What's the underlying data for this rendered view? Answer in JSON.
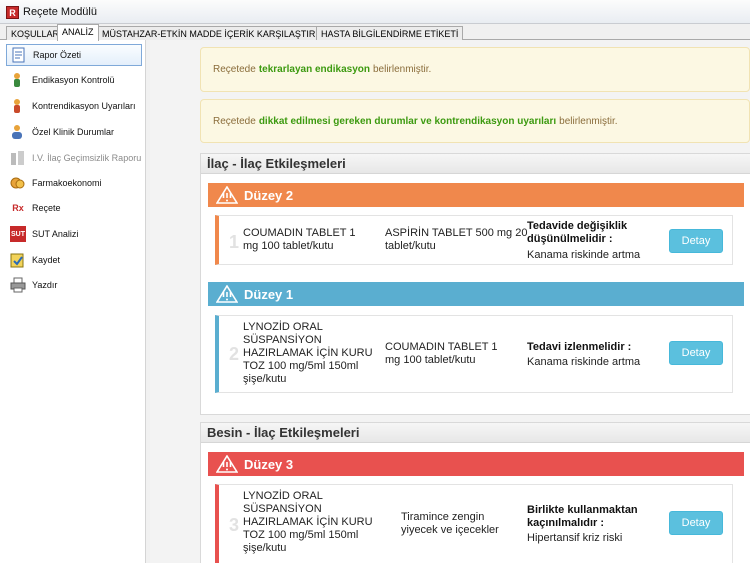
{
  "window": {
    "title": "Reçete Modülü",
    "icon": "app-logo-icon"
  },
  "tabs": [
    {
      "label": "KOŞULLAR",
      "active": false
    },
    {
      "label": "ANALİZ",
      "active": true
    },
    {
      "label": "MÜSTAHZAR-ETKİN MADDE İÇERİK KARŞILAŞTIRMA",
      "active": false
    },
    {
      "label": "HASTA BİLGİLENDİRME ETİKETİ",
      "active": false
    }
  ],
  "sidebar": {
    "items": [
      {
        "label": "Rapor Özeti",
        "icon": "report-icon",
        "active": true
      },
      {
        "label": "Endikasyon Kontrolü",
        "icon": "indication-icon"
      },
      {
        "label": "Kontrendikasyon Uyarıları",
        "icon": "contraindication-icon"
      },
      {
        "label": "Özel Klinik Durumlar",
        "icon": "patient-icon"
      },
      {
        "label": "I.V. İlaç Geçimsizlik Raporu",
        "icon": "iv-icon",
        "disabled": true
      },
      {
        "label": "Farmakoekonomi",
        "icon": "coins-icon"
      },
      {
        "label": "Reçete",
        "icon": "rx-icon"
      },
      {
        "label": "SUT Analizi",
        "icon": "sut-icon"
      },
      {
        "label": "Kaydet",
        "icon": "save-icon"
      },
      {
        "label": "Yazdır",
        "icon": "printer-icon"
      }
    ]
  },
  "alerts": [
    {
      "prefix": "Reçetede",
      "highlight": "tekrarlayan endikasyon",
      "suffix": "belirlenmiştir."
    },
    {
      "prefix": "Reçetede",
      "highlight": "dikkat edilmesi gereken durumlar ve kontrendikasyon uyarıları",
      "suffix": "belirlenmiştir."
    }
  ],
  "drug_interactions": {
    "title": "İlaç - İlaç Etkileşmeleri",
    "levels": [
      {
        "label": "Düzey 2",
        "color": "#f0884c",
        "card": {
          "number": "1",
          "drug1": "COUMADIN TABLET 1 mg 100 tablet/kutu",
          "drug2": "ASPİRİN TABLET 500 mg 20 tablet/kutu",
          "event_title": "Tedavide değişiklik düşünülmelidir :",
          "event_desc": "Kanama riskinde artma",
          "button": "Detay"
        }
      },
      {
        "label": "Düzey 1",
        "color": "#5aaed0",
        "card": {
          "number": "2",
          "drug1": "LYNOZİD ORAL SÜSPANSİYON HAZIRLAMAK İÇİN KURU TOZ 100 mg/5ml 150ml şişe/kutu",
          "drug2": "COUMADIN TABLET 1 mg 100 tablet/kutu",
          "event_title": "Tedavi izlenmelidir :",
          "event_desc": "Kanama riskinde artma",
          "button": "Detay"
        }
      }
    ]
  },
  "food_interactions": {
    "title": "Besin - İlaç Etkileşmeleri",
    "levels": [
      {
        "label": "Düzey 3",
        "color": "#e8514f",
        "card": {
          "number": "3",
          "drug1": "LYNOZİD ORAL SÜSPANSİYON HAZIRLAMAK İÇİN KURU TOZ 100 mg/5ml 150ml şişe/kutu",
          "drug2": "Tiramince zengin yiyecek ve içecekler",
          "event_title": "Birlikte kullanmaktan kaçınılmalıdır :",
          "event_desc": "Hipertansif kriz riski",
          "button": "Detay"
        }
      }
    ]
  }
}
